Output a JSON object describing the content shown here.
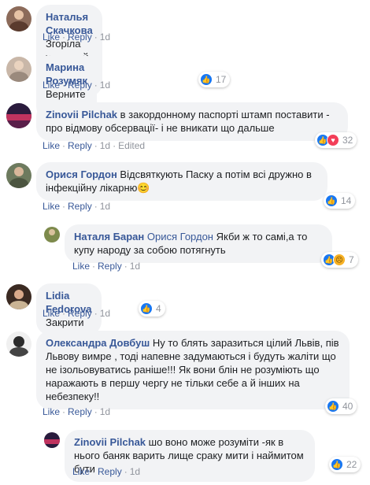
{
  "comments": [
    {
      "author": "Наталья Скачкова",
      "text": "Згоріла хата, хай горить стодола...",
      "actions": {
        "like": "Like",
        "reply": "Reply",
        "time": "1d"
      }
    },
    {
      "author": "Марина Розумяк",
      "text": "Верните их назад",
      "actions": {
        "like": "Like",
        "reply": "Reply",
        "time": "1d"
      },
      "reactions": {
        "count": "17",
        "icons": [
          "like-icon"
        ]
      }
    },
    {
      "author": "Zinovii Pilchak",
      "text": "в закордонному паспорті штамп поставити - про відмову обсервації- і не вникати що дальше",
      "actions": {
        "like": "Like",
        "reply": "Reply",
        "time": "1d",
        "edited": "Edited"
      },
      "reactions": {
        "count": "32",
        "icons": [
          "like-icon",
          "love-icon"
        ]
      }
    },
    {
      "author": "Орися Гордон",
      "text": "Відсвяткують Паску а потім всі дружно в інфекційну лікарню😊",
      "actions": {
        "like": "Like",
        "reply": "Reply",
        "time": "1d"
      },
      "reactions": {
        "count": "14",
        "icons": [
          "like-icon"
        ]
      }
    },
    {
      "author": "Наталя Баран",
      "mention": "Орися Гордон",
      "text": "Якби ж то самі,а то купу народу за собою потягнуть",
      "actions": {
        "like": "Like",
        "reply": "Reply",
        "time": "1d"
      },
      "reactions": {
        "count": "7",
        "icons": [
          "like-icon",
          "sad-icon"
        ]
      }
    },
    {
      "author": "Lidia Fedorova",
      "text": "Закрити",
      "actions": {
        "like": "Like",
        "reply": "Reply",
        "time": "1d"
      },
      "reactions": {
        "count": "4",
        "icons": [
          "like-icon"
        ]
      }
    },
    {
      "author": "Олександра Довбуш",
      "text": "Ну то блять заразиться цілий Львів, пів Львову вимре , тоді напевне задумаються і будуть жаліти що не ізольовуватись раніше!!! Як вони блін не розуміють що наражають в першу чергу не тільки себе а й інших на небезпеку!!",
      "actions": {
        "like": "Like",
        "reply": "Reply",
        "time": "1d"
      },
      "reactions": {
        "count": "40",
        "icons": [
          "like-icon"
        ]
      }
    },
    {
      "author": "Zinovii Pilchak",
      "text": "шо воно може розуміти -як в нього баняк варить лище сраку мити і наймитом бути",
      "actions": {
        "like": "Like",
        "reply": "Reply",
        "time": "1d"
      },
      "reactions": {
        "count": "22",
        "icons": [
          "like-icon"
        ]
      }
    }
  ],
  "colors": {
    "link": "#385898",
    "bubble": "#f2f3f5",
    "meta": "#90949c",
    "like": "#1877f2",
    "love": "#f33e58",
    "sad": "#f7b125"
  }
}
